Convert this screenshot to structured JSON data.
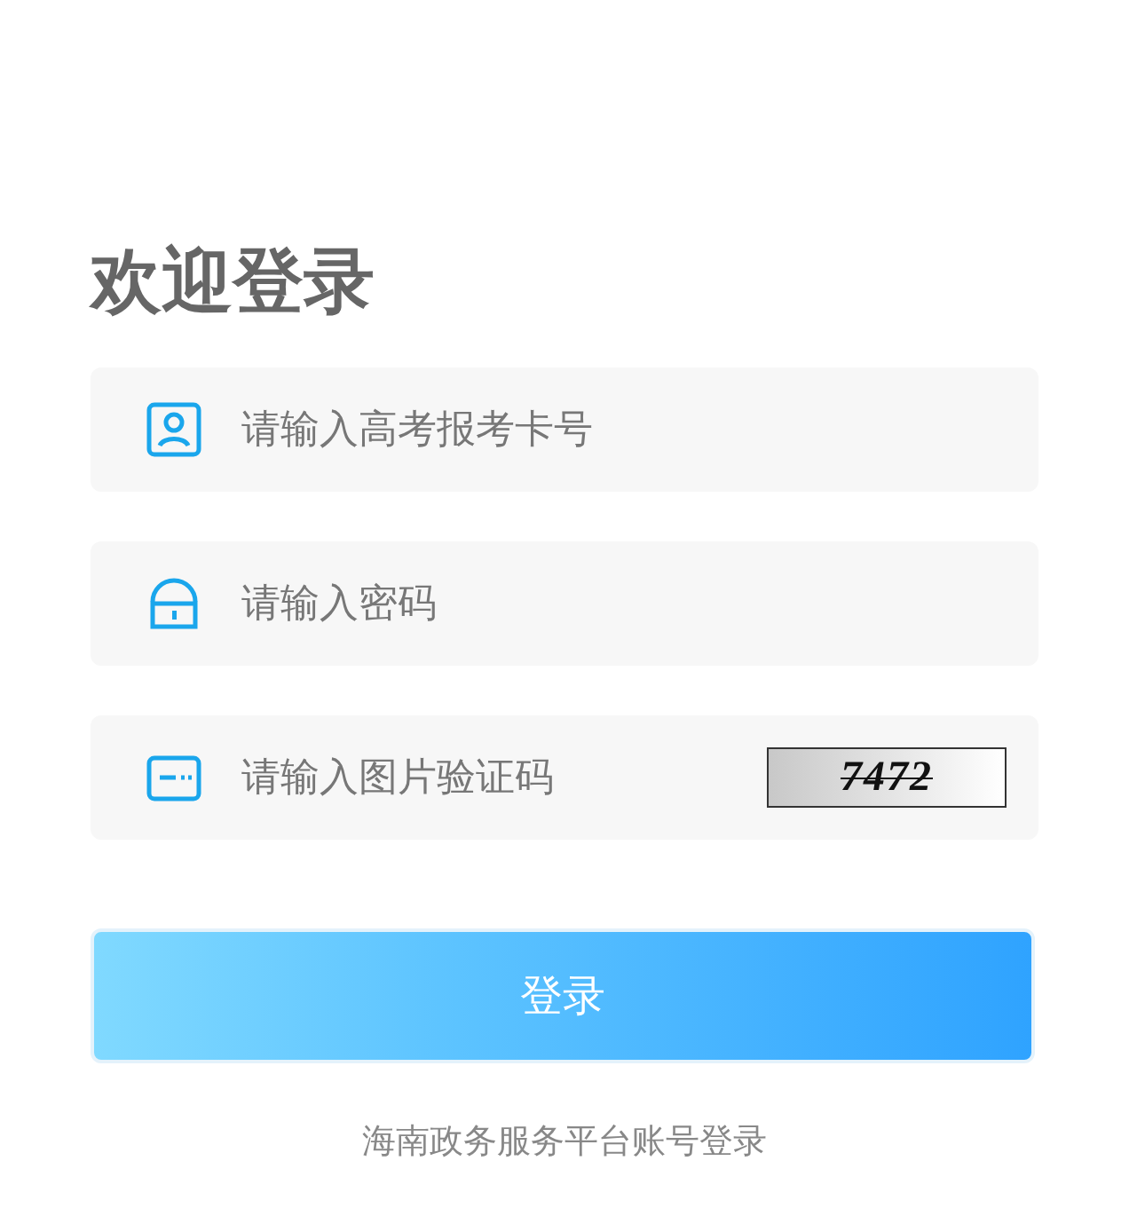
{
  "title": "欢迎登录",
  "fields": [
    {
      "kind": "user",
      "placeholder": "请输入高考报考卡号"
    },
    {
      "kind": "lock",
      "placeholder": "请输入密码"
    },
    {
      "kind": "code",
      "placeholder": "请输入图片验证码",
      "captcha": "7472"
    }
  ],
  "submit": "登录",
  "alt_login": "海南政务服务平台账号登录"
}
